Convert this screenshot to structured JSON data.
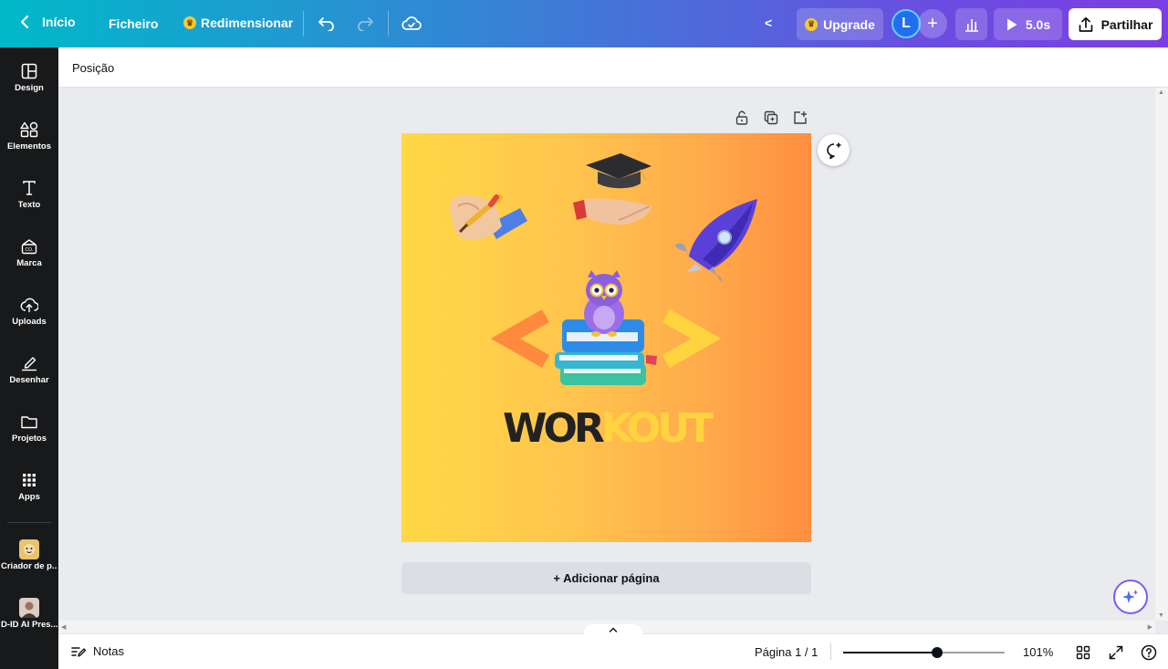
{
  "topbar": {
    "home_label": "Início",
    "file_label": "Ficheiro",
    "resize_label": "Redimensionar",
    "collapse_label": "<",
    "upgrade_label": "Upgrade",
    "avatar_initial": "L",
    "play_duration": "5.0s",
    "share_label": "Partilhar"
  },
  "sidebar": {
    "items": [
      {
        "label": "Design",
        "icon": "layout-icon"
      },
      {
        "label": "Elementos",
        "icon": "shapes-icon"
      },
      {
        "label": "Texto",
        "icon": "text-icon"
      },
      {
        "label": "Marca",
        "icon": "brand-icon"
      },
      {
        "label": "Uploads",
        "icon": "upload-cloud-icon"
      },
      {
        "label": "Desenhar",
        "icon": "draw-icon"
      },
      {
        "label": "Projetos",
        "icon": "folder-icon"
      },
      {
        "label": "Apps",
        "icon": "apps-grid-icon"
      }
    ],
    "apps": [
      {
        "label": "Criador de p...",
        "icon": "app-thumbnail-icon"
      },
      {
        "label": "D-ID AI Pres...",
        "icon": "app-thumbnail-icon"
      }
    ]
  },
  "context_bar": {
    "position_label": "Posição"
  },
  "canvas": {
    "design_title": "WORKOUT",
    "design_title_dark": "WOR",
    "design_title_light": "KOUT",
    "code_open": "<",
    "code_close": ">",
    "add_page_label": "+ Adicionar página",
    "colors": {
      "gradient_start": "#ffd845",
      "gradient_end": "#ff8e3e",
      "title_dark": "#222222",
      "title_light": "#ffd43f",
      "bracket_left": "#ff8a3d",
      "bracket_right": "#ffd43f"
    }
  },
  "footer": {
    "notes_label": "Notas",
    "page_indicator": "Página 1 / 1",
    "zoom_value": "101%",
    "zoom_fraction": 0.58
  },
  "brand": {
    "accent": "#7d3ee3",
    "teal": "#00b9c9"
  }
}
